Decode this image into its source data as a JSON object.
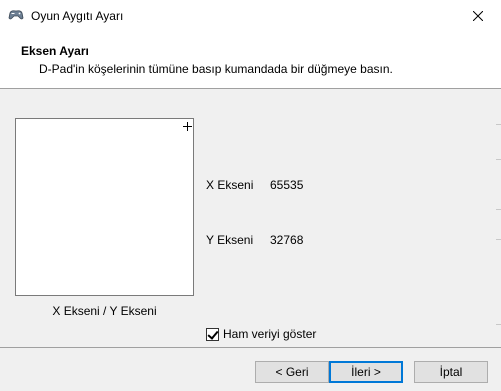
{
  "window": {
    "title": "Oyun Aygıtı Ayarı"
  },
  "header": {
    "title": "Eksen Ayarı",
    "subtitle": "D-Pad'in köşelerinin tümüne basıp kumandada bir düğmeye basın."
  },
  "axis_box": {
    "caption": "X Ekseni / Y Ekseni"
  },
  "readouts": {
    "x_label": "X Ekseni",
    "x_value": "65535",
    "y_label": "Y Ekseni",
    "y_value": "32768"
  },
  "raw_data": {
    "label": "Ham veriyi göster",
    "checked": true
  },
  "buttons": {
    "back": "< Geri",
    "next": "İleri >",
    "cancel": "İptal"
  },
  "icons": {
    "app": "gamepad-icon",
    "close": "close-icon",
    "crosshair": "crosshair-icon"
  },
  "colors": {
    "accent": "#0078d7"
  }
}
